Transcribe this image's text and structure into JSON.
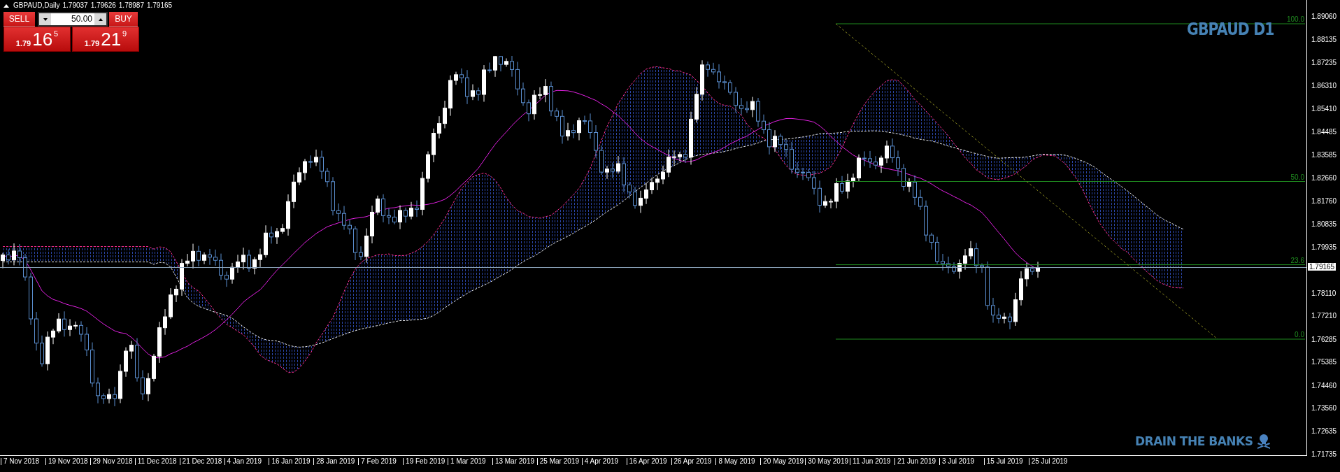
{
  "header": {
    "symbol": "GBPAUD,Daily",
    "prices": [
      "1.79037",
      "1.79626",
      "1.78987",
      "1.79165"
    ]
  },
  "trade_panel": {
    "sell_label": "SELL",
    "buy_label": "BUY",
    "lot": "50.00",
    "sell_price": {
      "prefix": "1.79",
      "main": "16",
      "sup": "5"
    },
    "buy_price": {
      "prefix": "1.79",
      "main": "21",
      "sup": "9"
    }
  },
  "chart_title": "GBPAUD D1",
  "signature": "DRAIN THE BANKS",
  "fib_levels": [
    {
      "label": "100.0"
    },
    {
      "label": "50.0"
    },
    {
      "label": "23.6"
    },
    {
      "label": "0.0"
    }
  ],
  "price_axis": {
    "ticks": [
      "1.89060",
      "1.88135",
      "1.87235",
      "1.86310",
      "1.85410",
      "1.84485",
      "1.83585",
      "1.82660",
      "1.81760",
      "1.80835",
      "1.79935",
      "1.78110",
      "1.77210",
      "1.76285",
      "1.75385",
      "1.74460",
      "1.73560",
      "1.72635",
      "1.71735"
    ],
    "current_price": "1.79165"
  },
  "date_axis": {
    "labels": [
      "7 Nov 2018",
      "19 Nov 2018",
      "29 Nov 2018",
      "11 Dec 2018",
      "21 Dec 2018",
      "4 Jan 2019",
      "16 Jan 2019",
      "28 Jan 2019",
      "7 Feb 2019",
      "19 Feb 2019",
      "1 Mar 2019",
      "13 Mar 2019",
      "25 Mar 2019",
      "4 Apr 2019",
      "16 Apr 2019",
      "26 Apr 2019",
      "8 May 2019",
      "20 May 2019",
      "30 May 2019",
      "11 Jun 2019",
      "21 Jun 2019",
      "3 Jul 2019",
      "15 Jul 2019",
      "25 Jul 2019"
    ]
  }
}
